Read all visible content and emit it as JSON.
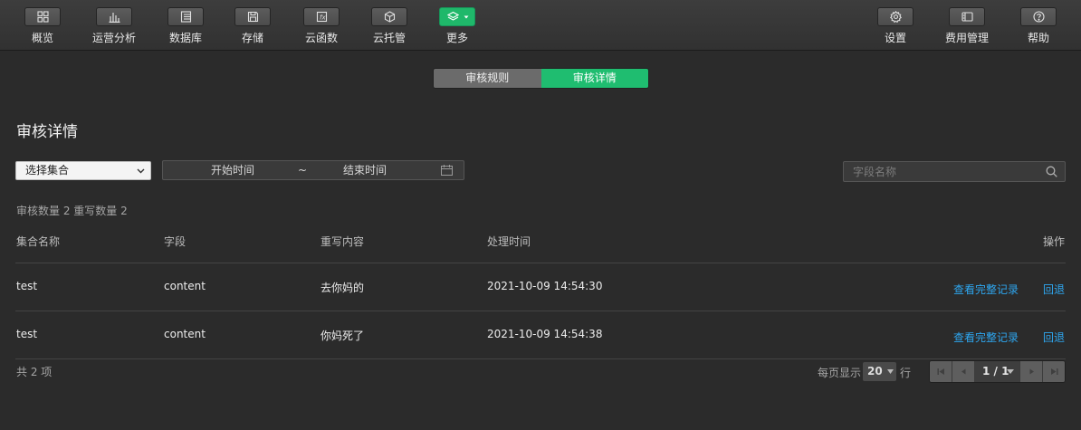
{
  "toolbar": {
    "left": [
      {
        "label": "概览",
        "icon": "grid-icon"
      },
      {
        "label": "运营分析",
        "icon": "bar-chart-icon"
      },
      {
        "label": "数据库",
        "icon": "database-icon"
      },
      {
        "label": "存储",
        "icon": "storage-icon"
      },
      {
        "label": "云函数",
        "icon": "function-icon"
      },
      {
        "label": "云托管",
        "icon": "cube-icon"
      },
      {
        "label": "更多",
        "icon": "layers-icon"
      }
    ],
    "right": [
      {
        "label": "设置",
        "icon": "gear-icon"
      },
      {
        "label": "费用管理",
        "icon": "billing-icon"
      },
      {
        "label": "帮助",
        "icon": "help-icon"
      }
    ]
  },
  "segmented": {
    "rules_label": "审核规则",
    "details_label": "审核详情",
    "active": "审核详情"
  },
  "page_title": "审核详情",
  "filters": {
    "collection_select": "选择集合",
    "date_start": "开始时间",
    "date_separator": "~",
    "date_end": "结束时间",
    "search_placeholder": "字段名称"
  },
  "summary": "审核数量 2 重写数量 2",
  "table": {
    "headers": {
      "collection": "集合名称",
      "field": "字段",
      "rewrite": "重写内容",
      "time": "处理时间",
      "actions": "操作"
    },
    "rows": [
      {
        "collection": "test",
        "field": "content",
        "rewrite": "去你妈的",
        "time": "2021-10-09 14:54:30",
        "view": "查看完整记录",
        "rollback": "回退"
      },
      {
        "collection": "test",
        "field": "content",
        "rewrite": "你妈死了",
        "time": "2021-10-09 14:54:38",
        "view": "查看完整记录",
        "rollback": "回退"
      }
    ]
  },
  "footer": {
    "total": "共 2 项",
    "per_page_label": "每页显示",
    "per_page_value": "20",
    "rows_unit": "行",
    "page_indicator": "1 / 1"
  },
  "colors": {
    "accent": "#1fbd70",
    "link": "#2ea6ef",
    "background": "#2b2b2b"
  }
}
